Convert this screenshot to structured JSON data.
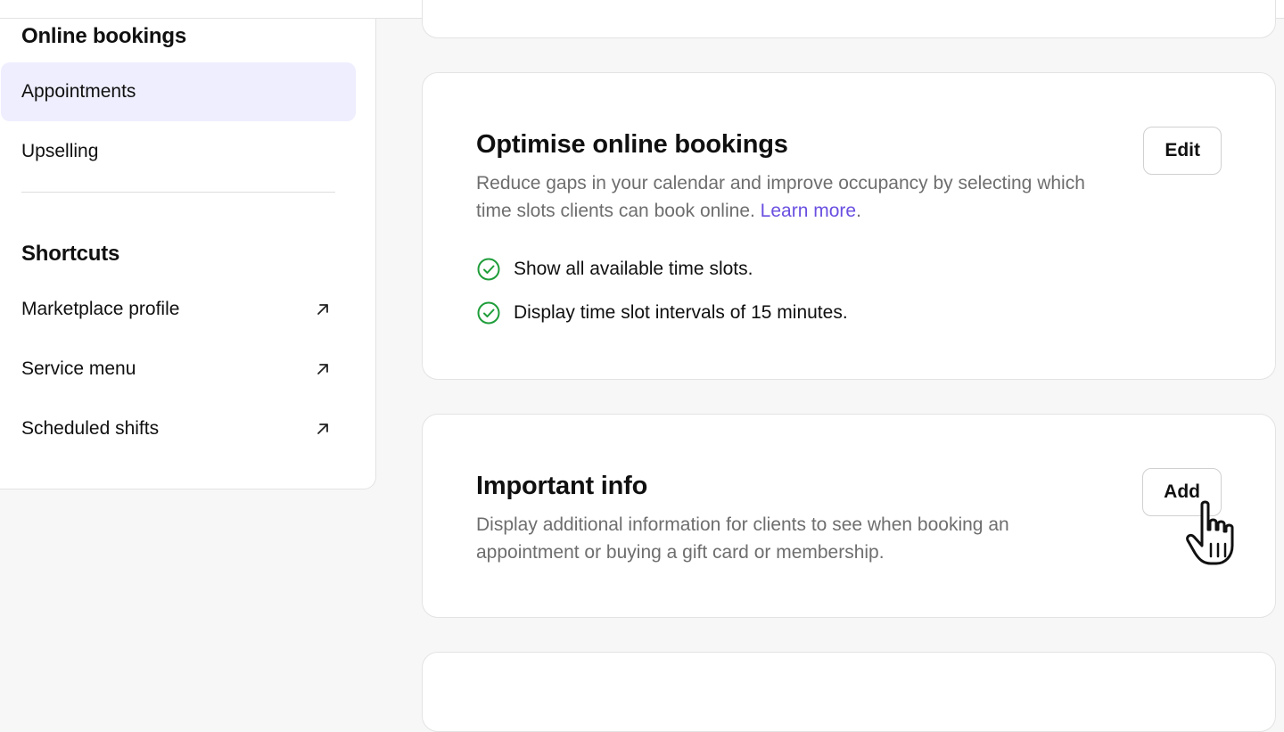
{
  "sidebar": {
    "online_bookings_heading": "Online bookings",
    "online_items": [
      {
        "label": "Appointments",
        "active": true
      },
      {
        "label": "Upselling",
        "active": false
      }
    ],
    "shortcuts_heading": "Shortcuts",
    "shortcut_items": [
      {
        "label": "Marketplace profile",
        "icon": "external-link-arrow-icon"
      },
      {
        "label": "Service menu",
        "icon": "external-link-arrow-icon"
      },
      {
        "label": "Scheduled shifts",
        "icon": "external-link-arrow-icon"
      }
    ],
    "active_bg": "#eeeeff"
  },
  "cards": {
    "optimise": {
      "title": "Optimise online bookings",
      "description": "Reduce gaps in your calendar and improve occupancy by selecting which time slots clients can book online.",
      "link_text": "Learn more",
      "link_suffix": ".",
      "button_label": "Edit",
      "checks": [
        "Show all available time slots.",
        "Display time slot intervals of 15 minutes."
      ],
      "check_color": "#1f9d3a"
    },
    "important_info": {
      "title": "Important info",
      "description": "Display additional information for clients to see when booking an appointment or buying a gift card or membership.",
      "button_label": "Add"
    }
  },
  "cursor": {
    "icon": "hand-pointer-icon"
  },
  "colors": {
    "accent_link": "#6a4fe0",
    "page_bg": "#f7f7f7",
    "card_bg": "#ffffff",
    "muted_text": "#6e6e6e"
  }
}
